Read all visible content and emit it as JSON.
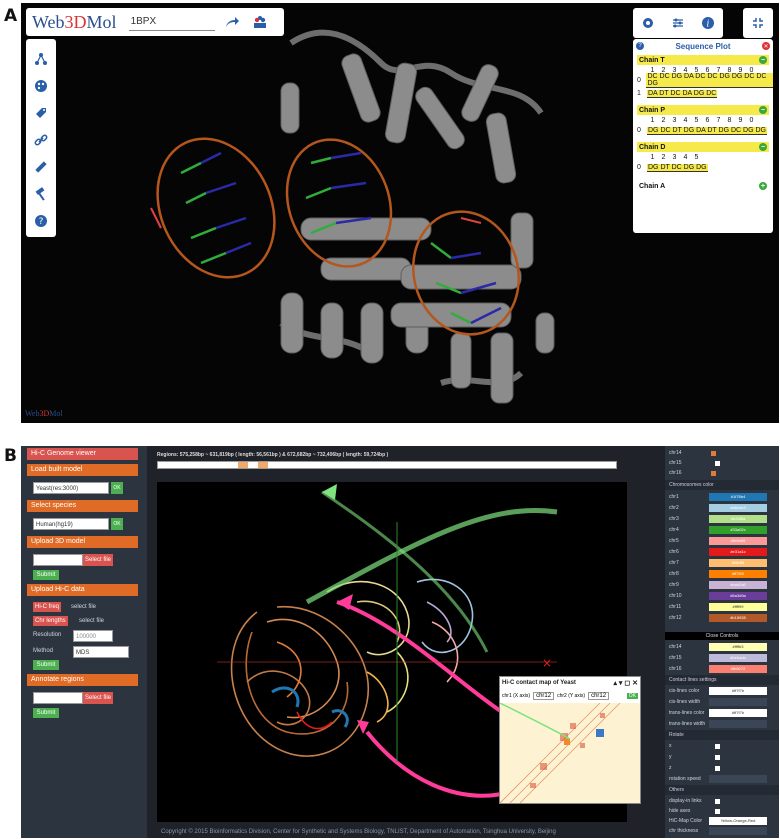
{
  "panel_labels": {
    "a": "A",
    "b": "B"
  },
  "panelA": {
    "logo": {
      "part1": "Web",
      "part2": "3D",
      "part3": "Mol"
    },
    "pdb_input_value": "1BPX",
    "top_icons": [
      "share-icon",
      "molecule-icon"
    ],
    "toolbar_icons": [
      "structure-icon",
      "palette-icon",
      "tag-icon",
      "link-icon",
      "measure-icon",
      "hammer-icon",
      "help-icon"
    ],
    "right_tools": [
      "gear-icon",
      "sliders-icon",
      "info-icon"
    ],
    "collapse_icon": "collapse-icon",
    "sequence_plot": {
      "title": "Sequence Plot",
      "help_glyph": "?",
      "close_glyph": "✕",
      "collapse_glyph": "−",
      "expand_glyph": "+",
      "number_ticks": [
        "1",
        "2",
        "3",
        "4",
        "5",
        "6",
        "7",
        "8",
        "9",
        "0"
      ],
      "chains": [
        {
          "name": "Chain T",
          "rows": [
            {
              "index": "0",
              "residues": "DC DC DG DA DC DC DG DG DC DC DG"
            },
            {
              "index": "1",
              "residues": "DA DT DC DA DG DC"
            }
          ]
        },
        {
          "name": "Chain P",
          "rows": [
            {
              "index": "0",
              "residues": "DG DC DT DG DA DT DG DC DG DG"
            }
          ]
        },
        {
          "name": "Chain D",
          "rows": [
            {
              "index": "0",
              "residues": "DG DT DC DG DG"
            }
          ]
        },
        {
          "name": "Chain A",
          "rows": []
        }
      ]
    },
    "footer": {
      "part1": "Web",
      "part2": "3D",
      "part3": "Mol"
    },
    "colors": {
      "helix": "#8a8a8a",
      "dna_backbone": "#b5561c",
      "dna_green": "#2fae3c",
      "dna_blue": "#2a2aa8"
    }
  },
  "panelB": {
    "left_sidebar": {
      "title": "Hi-C Genome viewer",
      "load_built_model": "Load built model",
      "model_select": "Yeast(res:3000)",
      "select_species": "Select species",
      "species_select": "Human(hg19)",
      "ok": "OK",
      "upload_3d_model": "Upload 3D model",
      "select_file": "Select file",
      "submit": "Submit",
      "upload_hic_data": "Upload Hi-C data",
      "hic_freq": "Hi-C freq",
      "chr_lengths": "Chr lengths",
      "select_file_text": "select file",
      "resolution_label": "Resolution",
      "resolution_value": "100000",
      "method_label": "Method",
      "method_value": "MDS",
      "annotate_regions": "Annotate regions"
    },
    "regions_text": "Regions: 575,258bp ~ 631,819bp ( length: 56,561bp ) & 672,682bp ~ 732,406bp ( length: 59,724bp )",
    "hic_map": {
      "title": "Hi-C contact map of Yeast",
      "x_axis_label": "chr1 (X axis)",
      "x_axis_value": "chr12",
      "y_axis_label": "chr2 (Y axis)",
      "y_axis_value": "chr12",
      "ok": "OK"
    },
    "copyright": "Copyright © 2015   Bioinformatics Division, Center for Synthetic and Systems Biology, TNLIST, Department of Automation, Tsinghua University, Beijing",
    "right_sidebar": {
      "top_chr": [
        "chr14",
        "chr15",
        "chr16"
      ],
      "chromosomes_color_label": "Chromosomes color",
      "chromosomes": [
        {
          "name": "chr1",
          "color": "#1f78b4"
        },
        {
          "name": "chr2",
          "color": "#a6cee3"
        },
        {
          "name": "chr3",
          "color": "#b2df8a"
        },
        {
          "name": "chr4",
          "color": "#33a02c"
        },
        {
          "name": "chr5",
          "color": "#fb9a99"
        },
        {
          "name": "chr6",
          "color": "#e31a1c"
        },
        {
          "name": "chr7",
          "color": "#fdbf6f"
        },
        {
          "name": "chr8",
          "color": "#ff7f00"
        },
        {
          "name": "chr9",
          "color": "#cab2d6"
        },
        {
          "name": "chr10",
          "color": "#6a3d9a"
        },
        {
          "name": "chr11",
          "color": "#ffff99"
        },
        {
          "name": "chr12",
          "color": "#b15928"
        }
      ],
      "close_controls": "Close Controls",
      "chromosomes_bottom": [
        {
          "name": "chr14",
          "color": "#ffffb3"
        },
        {
          "name": "chr15",
          "color": "#bebada"
        },
        {
          "name": "chr16",
          "color": "#fb8072"
        }
      ],
      "contact_lines_label": "Contact lines settings",
      "cis_color_label": "cis-lines color",
      "cis_color_value": "#ff7f7b",
      "cis_width_label": "cis-lines width",
      "trans_color_label": "trans-lines color",
      "trans_color_value": "#ff7f7b",
      "trans_width_label": "trans-lines width",
      "rotate_label": "Rotate",
      "rotate_axes": [
        "x",
        "y",
        "z"
      ],
      "rotation_speed_label": "rotation speed",
      "others_label": "Others",
      "display_links_label": "display-in links",
      "hide_axes_label": "hide axes",
      "hic_map_color_label": "HiC-Map Color",
      "hic_map_color_value": "Yellow-Orange-Red",
      "chr_thickness_label": "chr thickness"
    }
  }
}
